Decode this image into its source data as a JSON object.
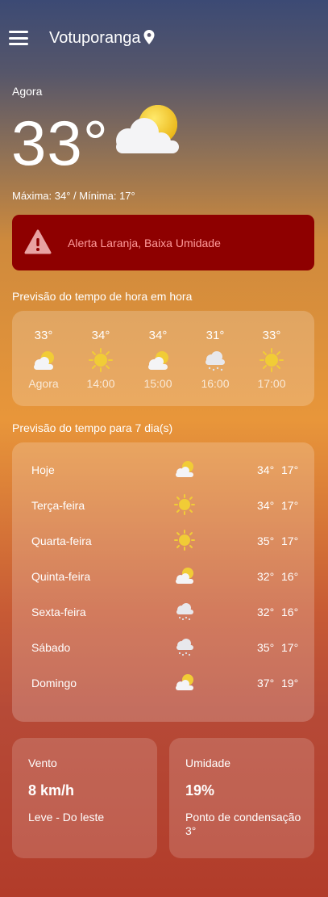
{
  "header": {
    "city": "Votuporanga"
  },
  "current": {
    "label": "Agora",
    "temperature": "33°",
    "minmax": "Máxima: 34° / Mínima: 17°",
    "icon": "sun-behind-cloud-icon"
  },
  "alert": {
    "text": "Alerta Laranja, Baixa Umidade",
    "color": "#8e0000"
  },
  "hourly": {
    "title": "Previsão do tempo de hora em hora",
    "items": [
      {
        "temp": "33°",
        "label": "Agora",
        "icon": "sun-behind-cloud-icon"
      },
      {
        "temp": "34°",
        "label": "14:00",
        "icon": "sun-icon"
      },
      {
        "temp": "34°",
        "label": "15:00",
        "icon": "sun-behind-cloud-icon"
      },
      {
        "temp": "31°",
        "label": "16:00",
        "icon": "rain-cloud-icon"
      },
      {
        "temp": "33°",
        "label": "17:00",
        "icon": "sun-icon"
      }
    ]
  },
  "daily": {
    "title": "Previsão do tempo para 7 dia(s)",
    "items": [
      {
        "day": "Hoje",
        "max": "34°",
        "min": "17°",
        "icon": "sun-behind-cloud-icon"
      },
      {
        "day": "Terça-feira",
        "max": "34°",
        "min": "17°",
        "icon": "sun-icon"
      },
      {
        "day": "Quarta-feira",
        "max": "35°",
        "min": "17°",
        "icon": "sun-icon"
      },
      {
        "day": "Quinta-feira",
        "max": "32°",
        "min": "16°",
        "icon": "sun-behind-cloud-icon"
      },
      {
        "day": "Sexta-feira",
        "max": "32°",
        "min": "16°",
        "icon": "rain-cloud-icon"
      },
      {
        "day": "Sábado",
        "max": "35°",
        "min": "17°",
        "icon": "rain-cloud-icon"
      },
      {
        "day": "Domingo",
        "max": "37°",
        "min": "19°",
        "icon": "sun-behind-cloud-icon"
      }
    ]
  },
  "wind": {
    "title": "Vento",
    "value": "8 km/h",
    "desc": "Leve - Do leste"
  },
  "humidity": {
    "title": "Umidade",
    "value": "19%",
    "desc": "Ponto de condensação 3°"
  }
}
